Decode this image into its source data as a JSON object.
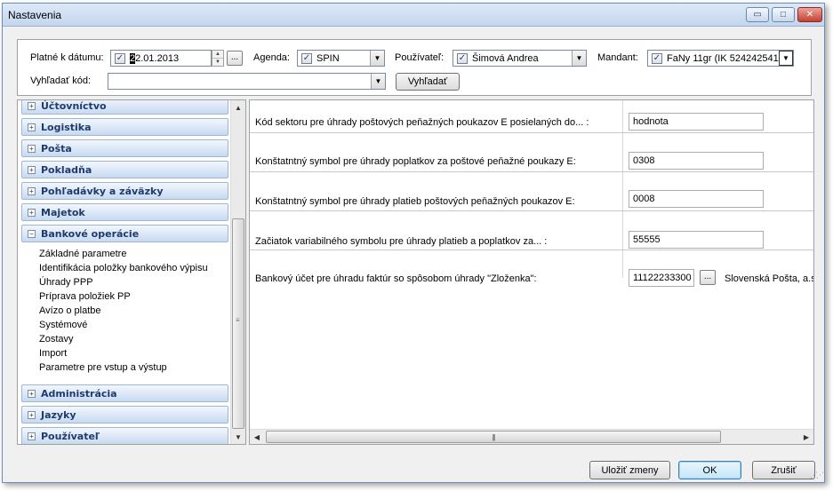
{
  "window": {
    "title": "Nastavenia",
    "controls": {
      "minimize": "▭",
      "maximize": "□",
      "close": "✕"
    }
  },
  "filters": {
    "date_label": "Platné k dátumu:",
    "date_value": "2.01.2013",
    "date_caret": "2",
    "agenda_label": "Agenda:",
    "agenda_value": "SPIN",
    "user_label": "Používateľ:",
    "user_value": "Šimová Andrea",
    "mandant_label": "Mandant:",
    "mandant_value": "FaNy 11gr (IK 524242541",
    "search_label": "Vyhľadať kód:",
    "search_value": "",
    "search_button": "Vyhľadať",
    "dots": "..."
  },
  "nav": {
    "groups": [
      {
        "label": "Účtovníctvo",
        "expander": "+"
      },
      {
        "label": "Logistika",
        "expander": "+"
      },
      {
        "label": "Pošta",
        "expander": "+"
      },
      {
        "label": "Pokladňa",
        "expander": "+"
      },
      {
        "label": "Pohľadávky a záväzky",
        "expander": "+"
      },
      {
        "label": "Majetok",
        "expander": "+"
      },
      {
        "label": "Bankové operácie",
        "expander": "−"
      },
      {
        "label": "Administrácia",
        "expander": "+"
      },
      {
        "label": "Jazyky",
        "expander": "+"
      },
      {
        "label": "Používateľ",
        "expander": "+"
      }
    ],
    "subitems": [
      "Základné parametre",
      "Identifikácia položky bankového výpisu",
      "Úhrady PPP",
      "Príprava položiek PP",
      "Avízo o platbe",
      "Systémové",
      "Zostavy",
      "Import",
      "Parametre pre vstup a výstup"
    ]
  },
  "settings": [
    {
      "label": "Kód sektoru pre úhrady poštových peňažných poukazov E posielaných do... :",
      "value": "hodnota"
    },
    {
      "label": "Konštatntný symbol pre úhrady poplatkov za poštové peňažné poukazy E:",
      "value": "0308"
    },
    {
      "label": "Konštatntný symbol pre úhrady platieb poštových peňažných poukazov E:",
      "value": "0008"
    },
    {
      "label": "Začiatok variabilného symbolu pre úhrady platieb a poplatkov za... :",
      "value": "55555"
    },
    {
      "label": "Bankový účet pre úhradu faktúr so spôsobom úhrady \"Zloženka\":",
      "value": "11122233300",
      "extra": "Slovenská Pošta, a.s"
    }
  ],
  "footer": {
    "save": "Uložiť zmeny",
    "ok": "OK",
    "cancel": "Zrušiť"
  }
}
